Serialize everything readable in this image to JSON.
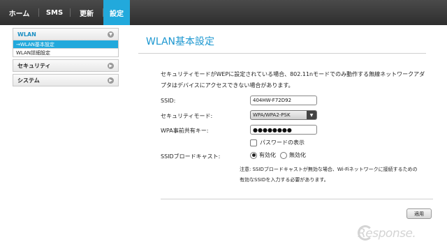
{
  "nav": {
    "tabs": [
      {
        "label": "ホーム"
      },
      {
        "label": "SMS"
      },
      {
        "label": "更新"
      },
      {
        "label": "設定"
      }
    ],
    "active_color": "#22a9dc"
  },
  "sidebar": {
    "groups": [
      {
        "label": "WLAN",
        "items": [
          {
            "label": "→WLAN基本設定"
          },
          {
            "label": "WLAN詳細設定"
          }
        ]
      },
      {
        "label": "セキュリティ"
      },
      {
        "label": "システム"
      }
    ]
  },
  "main": {
    "title": "WLAN基本設定",
    "title_color": "#1c97d0",
    "description": "セキュリティモードがWEPに設定されている場合、802.11nモードでのみ動作する無線ネットワークアダプタはデバイスにアクセスできない場合があります。",
    "fields": {
      "ssid_label": "SSID:",
      "ssid_value": "404HW-F72D92",
      "security_label": "セキュリティモード:",
      "security_value": "WPA/WPA2-PSK",
      "psk_label": "WPA事前共有キー:",
      "psk_value": "●●●●●●●●",
      "show_password_label": "パスワードの表示",
      "broadcast_label": "SSIDブロードキャスト:",
      "broadcast_on": "有効化",
      "broadcast_off": "無効化"
    },
    "note": "注意: SSIDブロードキャストが無効な場合、Wi-Fiネットワークに接続するための有効なSSIDを入力する必要があります。",
    "apply_label": "適用"
  },
  "watermark": "Response."
}
